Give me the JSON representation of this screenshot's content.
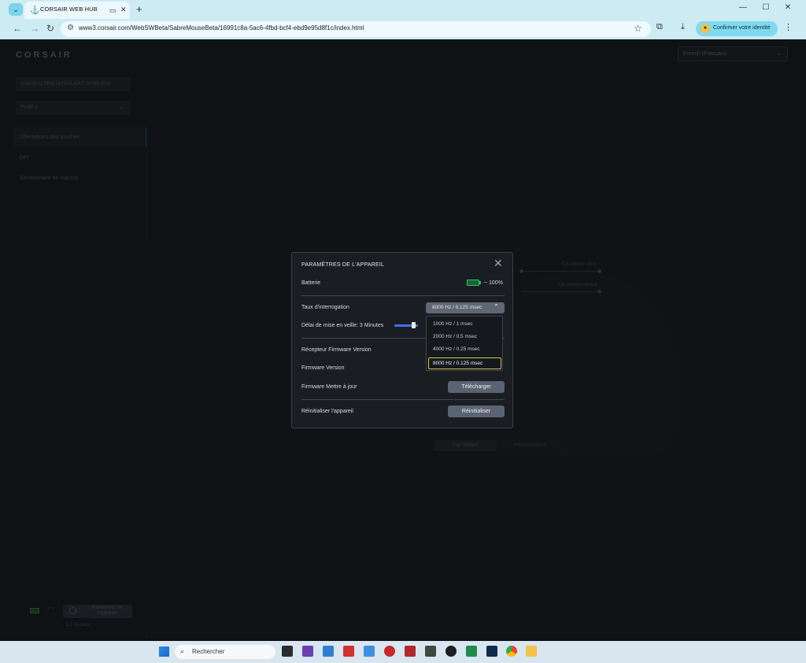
{
  "browser": {
    "tab_title": "CORSAIR WEB HUB",
    "url": "www3.corsair.com/WebSWBeta/SabreMouseBeta/16991c8a-5ac6-4fbd-bcf4-ebd9e95d8f1c/index.html",
    "identity_button": "Confirmer votre identité"
  },
  "app": {
    "brand": "CORSAIR",
    "language": "French (Français)",
    "device_name": "SABRE v2 PRO ULTRALIGHT WIRELESS",
    "profile": "Profil 1",
    "nav": [
      "Affectations des touches",
      "DPI",
      "Gestionnaire de macros"
    ],
    "callouts": [
      "Clic bouton droit",
      "Clic bouton central"
    ],
    "bottom_buttons": {
      "default": "Par défaut",
      "custom": "Personnalisé"
    },
    "footer": {
      "settings_label": "Paramètres de l'appareil",
      "version": "1.0.35-beta"
    }
  },
  "modal": {
    "title": "PARAMÈTRES DE L'APPAREIL",
    "battery_label": "Batterie",
    "battery_value": "~ 100%",
    "battery_level": 1.0,
    "battery_color": "#23c55e",
    "polling_label": "Taux d'interrogation",
    "polling_value": "8000 Hz / 0.125 msec",
    "polling_options": [
      "1000 Hz / 1 msec",
      "2000 Hz / 0.5 msec",
      "4000 Hz / 0.25 msec",
      "8000 Hz / 0.125 msec"
    ],
    "sleep_label": "Délai de mise en veille: 3 Minutes",
    "receiver_fw_label": "Récepteur Firmware Version",
    "fw_label": "Firmware Version",
    "fw_update_label": "Firmware Mettre à jour",
    "download_button": "Télécharger",
    "reset_label": "Réinitialiser l'appareil",
    "reset_button": "Réinitialiser"
  },
  "taskbar": {
    "search_placeholder": "Rechercher"
  }
}
